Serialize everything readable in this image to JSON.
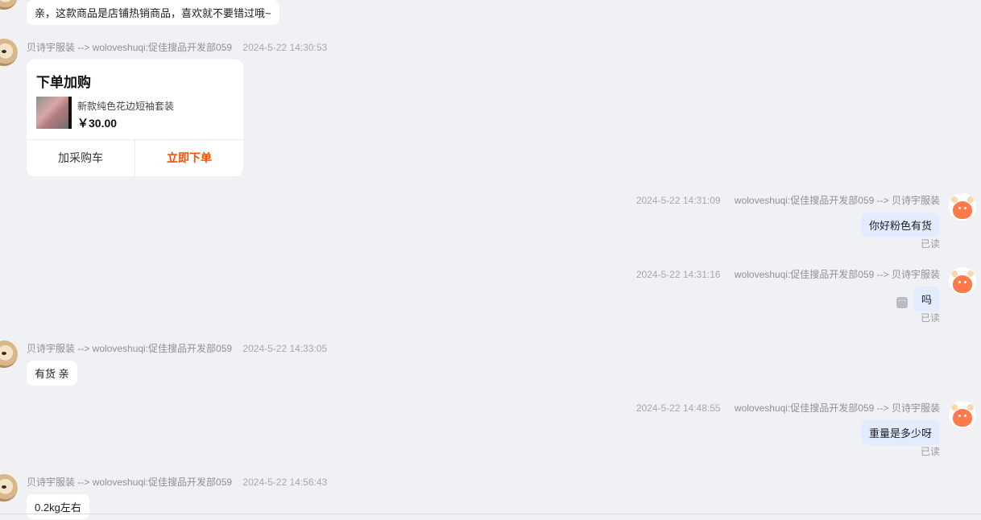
{
  "messages": [
    {
      "text": "亲，这款商品是店铺热销商品，喜欢就不要错过哦~"
    },
    {
      "names": "贝诗宇服装 --> woloveshuqi:促佳搜品开发部059",
      "time": "2024-5-22 14:30:53"
    },
    {
      "time": "2024-5-22 14:31:09",
      "names": "woloveshuqi:促佳搜品开发部059 --> 贝诗宇服装",
      "text": "你好粉色有货",
      "status": "已读"
    },
    {
      "time": "2024-5-22 14:31:16",
      "names": "woloveshuqi:促佳搜品开发部059 --> 贝诗宇服装",
      "text": "吗",
      "status": "已读"
    },
    {
      "names": "贝诗宇服装 --> woloveshuqi:促佳搜品开发部059",
      "time": "2024-5-22 14:33:05",
      "text": "有货 亲"
    },
    {
      "time": "2024-5-22 14:48:55",
      "names": "woloveshuqi:促佳搜品开发部059 --> 贝诗宇服装",
      "text": "重量是多少呀",
      "status": "已读"
    },
    {
      "names": "贝诗宇服装 --> woloveshuqi:促佳搜品开发部059",
      "time": "2024-5-22 14:56:43",
      "text": "0.2kg左右"
    }
  ],
  "order_card": {
    "title": "下单加购",
    "product_name": "新款纯色花边短袖套装",
    "price": "￥30.00",
    "cart_label": "加采购车",
    "order_label": "立即下单"
  },
  "icons": [
    "dog-avatar-icon",
    "cow-avatar-icon",
    "more-icon"
  ]
}
